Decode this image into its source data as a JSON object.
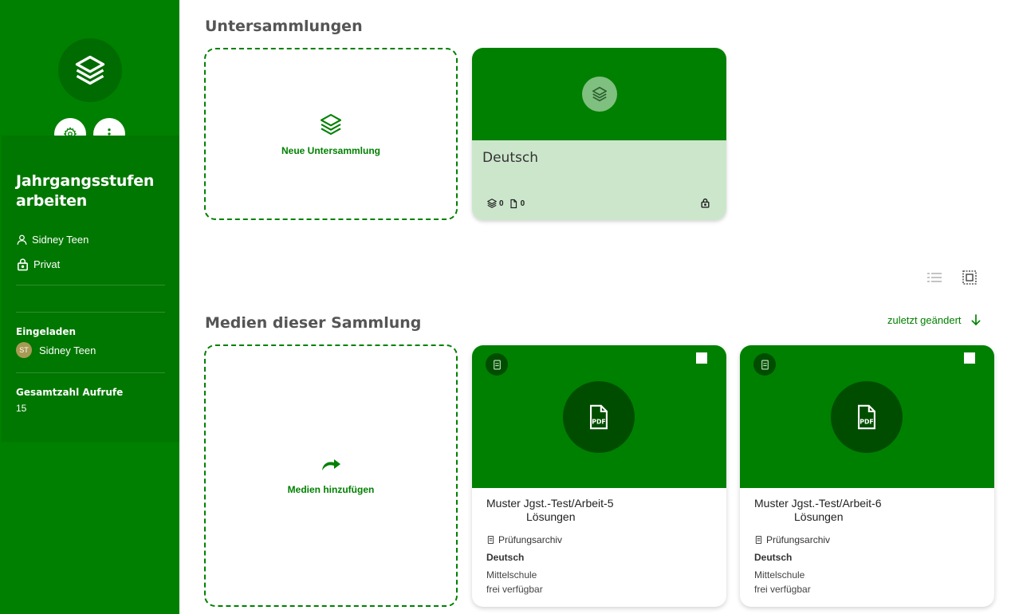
{
  "sidebar": {
    "title": "Jahrgangsstufen arbeiten",
    "owner": "Sidney Teen",
    "visibility": "Privat",
    "invited_label": "Eingeladen",
    "invited_user": {
      "initials": "ST",
      "name": "Sidney Teen"
    },
    "views_label": "Gesamtzahl Aufrufe",
    "views_count": "15"
  },
  "subcollections": {
    "heading": "Untersammlungen",
    "new_label": "Neue Untersammlung",
    "items": [
      {
        "name": "Deutsch",
        "collections_count": "0",
        "media_count": "0"
      }
    ]
  },
  "media": {
    "heading": "Medien dieser Sammlung",
    "sort_label": "zuletzt geändert",
    "add_label": "Medien hinzufügen",
    "items": [
      {
        "title_line1": "Muster Jgst.-Test/Arbeit-5",
        "title_line2": "Lösungen",
        "archive": "Prüfungsarchiv",
        "subject": "Deutsch",
        "school": "Mittelschule",
        "license": "frei verfügbar",
        "file_type": "PDF"
      },
      {
        "title_line1": "Muster Jgst.-Test/Arbeit-6",
        "title_line2": "Lösungen",
        "archive": "Prüfungsarchiv",
        "subject": "Deutsch",
        "school": "Mittelschule",
        "license": "frei verfügbar",
        "file_type": "PDF"
      }
    ]
  },
  "colors": {
    "brand": "#008000",
    "dark": "#004d00",
    "light": "#cce6cc"
  }
}
